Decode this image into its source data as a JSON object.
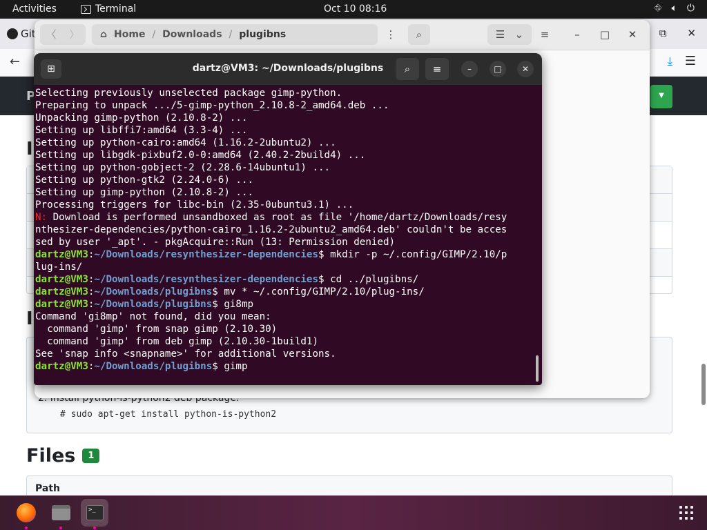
{
  "topbar": {
    "activities": "Activities",
    "app_name": "Terminal",
    "clock": "Oct 10  08:16",
    "tray_icons": [
      "network-icon",
      "volume-icon",
      "power-icon"
    ]
  },
  "browser": {
    "tab_title": "Git",
    "page_title_fragment": "P",
    "step_text": "2. Install python-is-python2 deb package:",
    "command_text": "# sudo apt-get install python-is-python2",
    "files_heading": "Files",
    "files_count": "1",
    "path_header": "Path"
  },
  "files_window": {
    "path_home": "Home",
    "path_downloads": "Downloads",
    "path_current": "plugibns"
  },
  "terminal": {
    "title": "dartz@VM3: ~/Downloads/plugibns",
    "lines": [
      {
        "text": "Selecting previously unselected package gimp-python."
      },
      {
        "text": "Preparing to unpack .../5-gimp-python_2.10.8-2_amd64.deb ..."
      },
      {
        "text": "Unpacking gimp-python (2.10.8-2) ..."
      },
      {
        "text": "Setting up libffi7:amd64 (3.3-4) ..."
      },
      {
        "text": "Setting up python-cairo:amd64 (1.16.2-2ubuntu2) ..."
      },
      {
        "text": "Setting up libgdk-pixbuf2.0-0:amd64 (2.40.2-2build4) ..."
      },
      {
        "text": "Setting up python-gobject-2 (2.28.6-14ubuntu1) ..."
      },
      {
        "text": "Setting up python-gtk2 (2.24.0-6) ..."
      },
      {
        "text": "Setting up gimp-python (2.10.8-2) ..."
      },
      {
        "text": "Processing triggers for libc-bin (2.35-0ubuntu3.1) ..."
      },
      {
        "warn": "N:",
        "text": " Download is performed unsandboxed as root as file '/home/dartz/Downloads/resy"
      },
      {
        "text": "nthesizer-dependencies/python-cairo_1.16.2-2ubuntu2_amd64.deb' couldn't be acces"
      },
      {
        "text": "sed by user '_apt'. - pkgAcquire::Run (13: Permission denied)"
      },
      {
        "user": "dartz@VM3",
        "path": "~/Downloads/resynthesizer-dependencies",
        "text": "$ mkdir -p ~/.config/GIMP/2.10/p"
      },
      {
        "text": "lug-ins/"
      },
      {
        "user": "dartz@VM3",
        "path": "~/Downloads/resynthesizer-dependencies",
        "text": "$ cd ../plugibns/"
      },
      {
        "user": "dartz@VM3",
        "path": "~/Downloads/plugibns",
        "text": "$ mv * ~/.config/GIMP/2.10/plug-ins/"
      },
      {
        "user": "dartz@VM3",
        "path": "~/Downloads/plugibns",
        "text": "$ gi8mp"
      },
      {
        "text": "Command 'gi8mp' not found, did you mean:"
      },
      {
        "text": "  command 'gimp' from snap gimp (2.10.30)"
      },
      {
        "text": "  command 'gimp' from deb gimp (2.10.30-1build1)"
      },
      {
        "text": "See 'snap info <snapname>' for additional versions."
      },
      {
        "user": "dartz@VM3",
        "path": "~/Downloads/plugibns",
        "text": "$ gimp"
      }
    ]
  },
  "dock": {
    "items": [
      "firefox-icon",
      "files-icon",
      "terminal-icon"
    ],
    "apps_grid": "show-apps-icon"
  }
}
